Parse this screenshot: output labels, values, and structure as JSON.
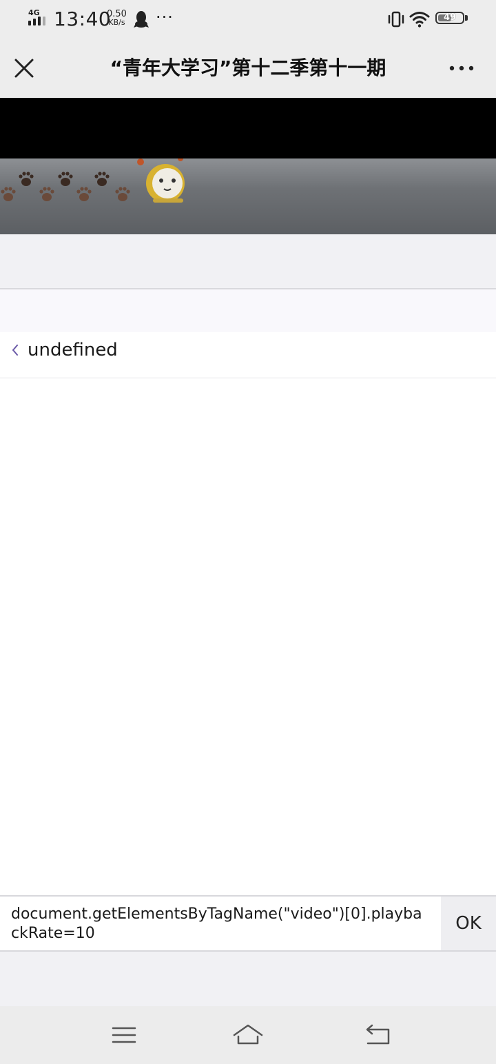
{
  "status_bar": {
    "network": "4G",
    "time": "13:40",
    "speed_value": "0.50",
    "speed_unit": "KB/s",
    "more_indicator": "···",
    "battery": "49",
    "icons": [
      "signal-icon",
      "qq-icon",
      "vibrate-icon",
      "wifi-icon",
      "battery-icon"
    ]
  },
  "titlebar": {
    "title": "“青年大学习”第十二季第十一期",
    "close_icon": "close-icon",
    "more_icon": "more-icon"
  },
  "console": {
    "log_entries": [
      {
        "text": "undefined",
        "icon": "result-arrow-icon"
      }
    ],
    "input_value": "document.getElementsByTagName(\"video\")[0].playbackRate=10",
    "ok_label": "OK"
  },
  "navbar": {
    "icons": [
      "menu-icon",
      "home-icon",
      "back-icon"
    ]
  },
  "colors": {
    "bar_bg": "#ededed",
    "console_gray": "#f1f1f4",
    "arrow_accent": "#6b5aa8"
  }
}
